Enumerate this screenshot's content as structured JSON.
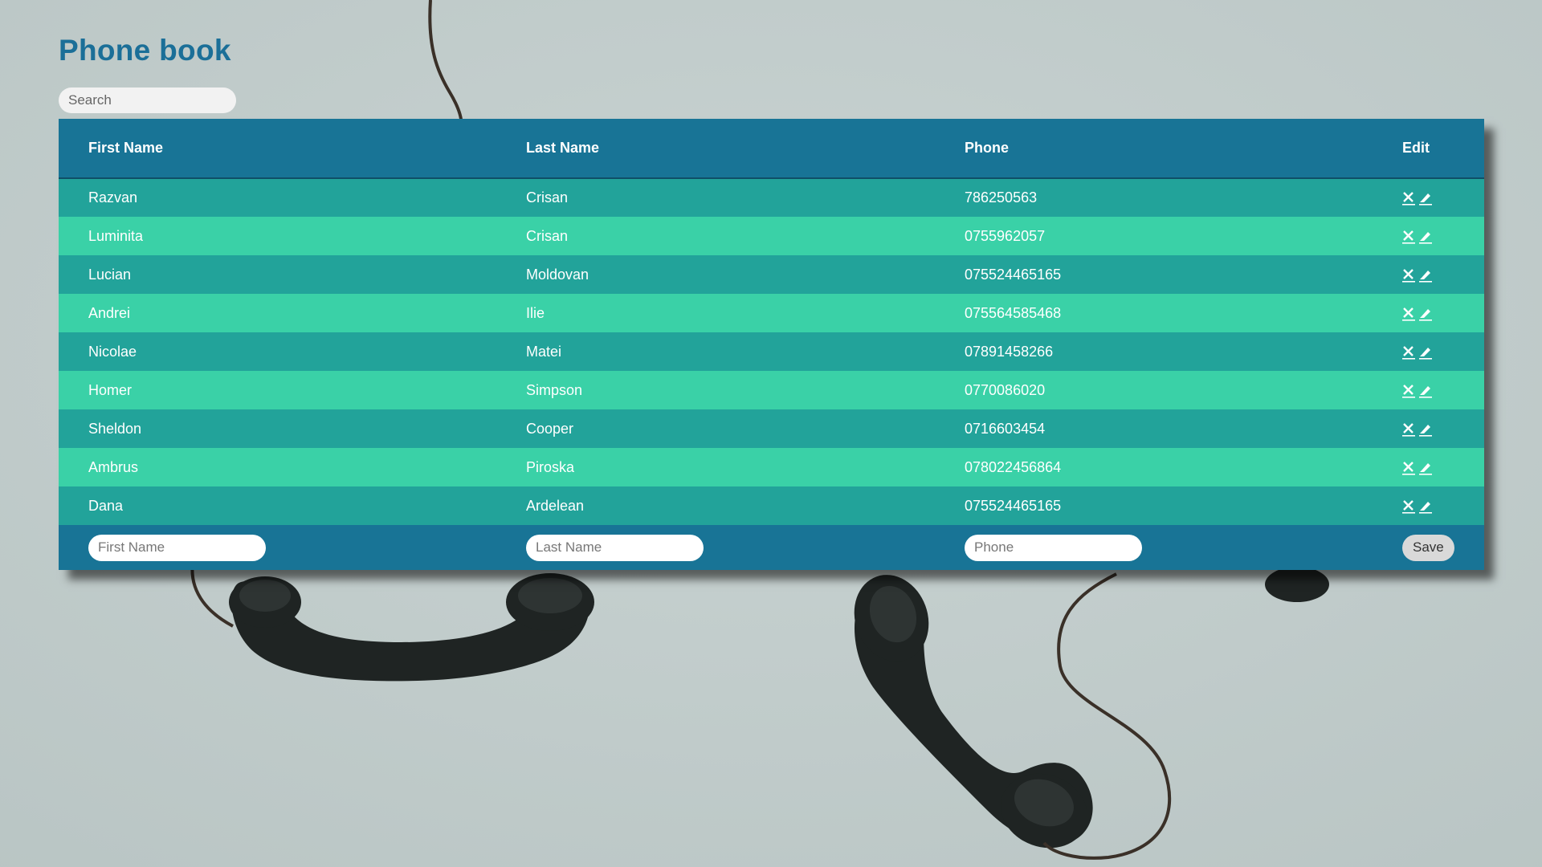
{
  "page": {
    "title": "Phone book"
  },
  "search": {
    "placeholder": "Search"
  },
  "table": {
    "headers": [
      "First Name",
      "Last Name",
      "Phone",
      "Edit"
    ],
    "rows": [
      {
        "first": "Razvan",
        "last": "Crisan",
        "phone": "786250563"
      },
      {
        "first": "Luminita",
        "last": "Crisan",
        "phone": "0755962057"
      },
      {
        "first": "Lucian",
        "last": "Moldovan",
        "phone": "075524465165"
      },
      {
        "first": "Andrei",
        "last": "Ilie",
        "phone": "075564585468"
      },
      {
        "first": "Nicolae",
        "last": "Matei",
        "phone": "07891458266"
      },
      {
        "first": "Homer",
        "last": "Simpson",
        "phone": "0770086020"
      },
      {
        "first": "Sheldon",
        "last": "Cooper",
        "phone": "0716603454"
      },
      {
        "first": "Ambrus",
        "last": "Piroska",
        "phone": "078022456864"
      },
      {
        "first": "Dana",
        "last": "Ardelean",
        "phone": "075524465165"
      }
    ],
    "row_actions": {
      "delete_icon": "close-icon",
      "edit_icon": "pencil-icon"
    }
  },
  "add_form": {
    "first_placeholder": "First Name",
    "last_placeholder": "Last Name",
    "phone_placeholder": "Phone",
    "save_label": "Save"
  },
  "colors": {
    "title": "#1b6f98",
    "header_bg": "#187496",
    "row_dark": "#22a39a",
    "row_light": "#3ad1a7",
    "page_bg": "#c1cccc"
  },
  "background": {
    "image": "vintage-telephone-receivers"
  }
}
